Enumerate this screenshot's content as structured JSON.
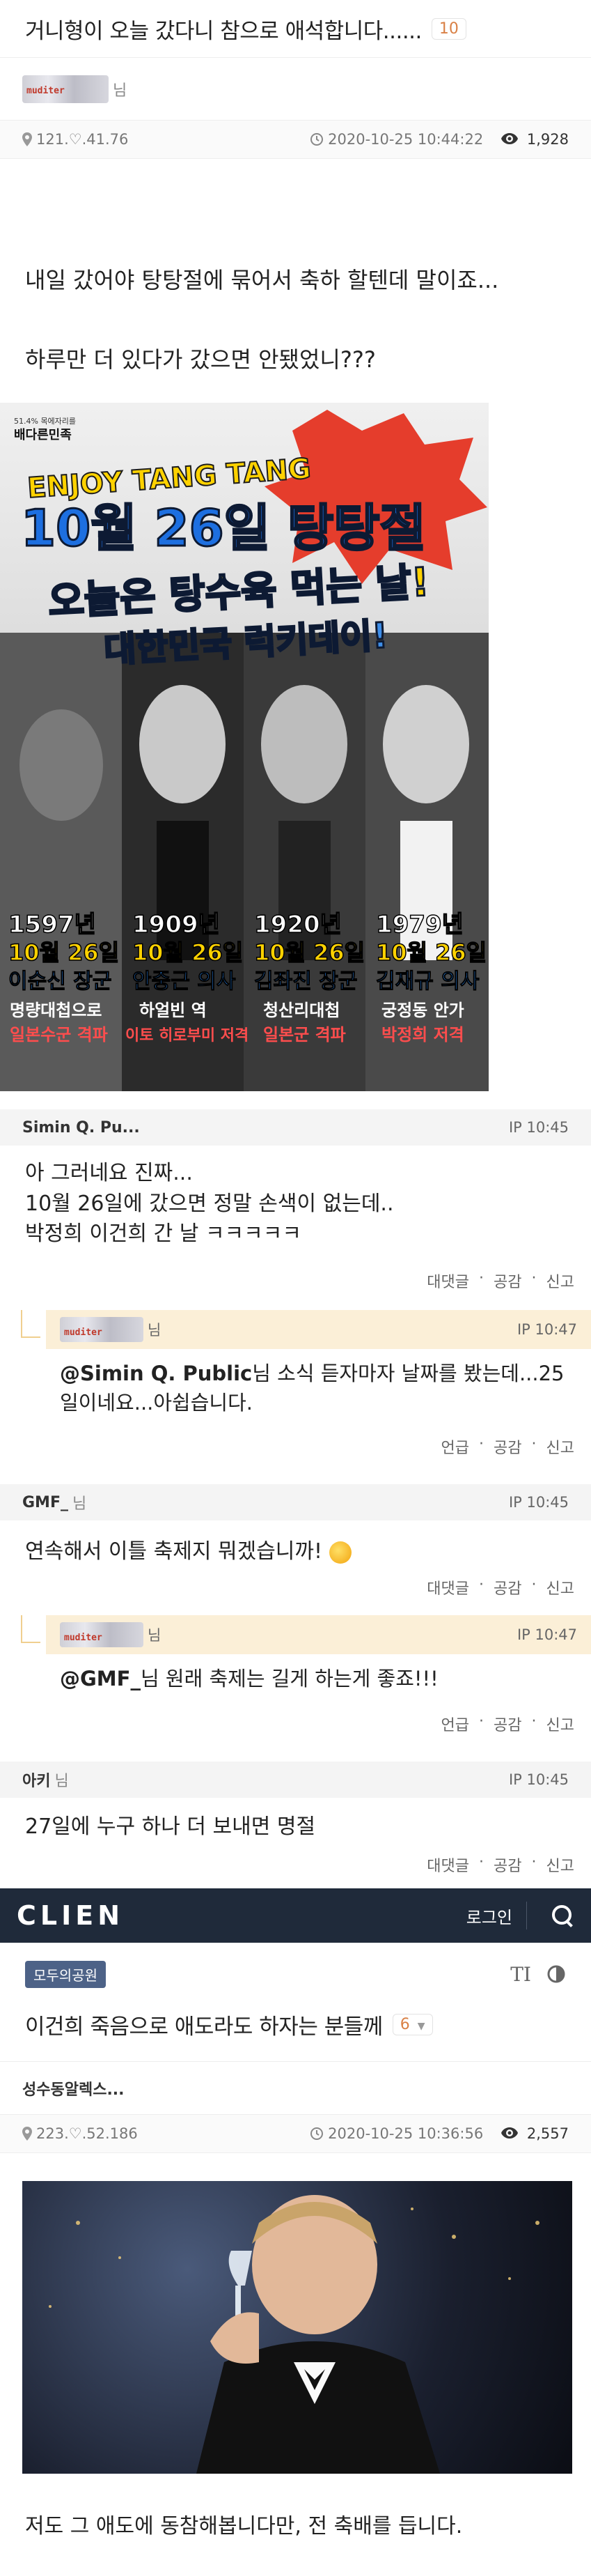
{
  "post1": {
    "title": "거니형이 오늘 갔다니 참으로 애석합니다......",
    "comment_count": "10",
    "author_suffix": "님",
    "ip": "121.♡.41.76",
    "datetime": "2020-10-25 10:44:22",
    "views": "1,928",
    "body_lines": [
      "내일 갔어야 탕탕절에 묶어서 축하 할텐데 말이죠...",
      "하루만 더 있다가 갔으면 안됐었니???"
    ],
    "nick_image_text": "muditer"
  },
  "poster": {
    "badge_small": "51.4% 목에자리를",
    "badge_brand": "배다른민족",
    "line1": "ENJOY TANG TANG",
    "line2": "10월 26일 탕탕절",
    "line3": "오늘은 탕수육 먹는 날!",
    "line4": "대한민국 럭키데이!",
    "cards": [
      {
        "year": "1597년",
        "date": "10월 26일",
        "name": "이순신 장군",
        "desc1": "명량대첩으로",
        "desc2": "일본수군 격파"
      },
      {
        "year": "1909년",
        "date": "10월 26일",
        "name": "안중근 의사",
        "desc1": "하얼빈 역",
        "desc2": "이토 히로부미 저격"
      },
      {
        "year": "1920년",
        "date": "10월 26일",
        "name": "김좌진 장군",
        "desc1": "청산리대첩",
        "desc2": "일본군 격파"
      },
      {
        "year": "1979년",
        "date": "10월 26일",
        "name": "김재규 의사",
        "desc1": "궁정동 안가",
        "desc2": "박정희 저격"
      }
    ]
  },
  "actions": {
    "reply": "대댓글",
    "sep": "·",
    "like": "공감",
    "report": "신고",
    "mention": "언급"
  },
  "comments": [
    {
      "nick": "Simin Q. Pu...",
      "ip": "IP 10:45",
      "lines": [
        "아 그러네요 진짜...",
        "10월 26일에 갔으면 정말 손색이 없는데..",
        "박정희 이건희 간 날 ㅋㅋㅋㅋㅋ"
      ]
    },
    {
      "nick": "GMF_",
      "suffix": "님",
      "ip": "IP 10:45",
      "lines": [
        "연속해서 이틀 축제지 뭐겠습니까!"
      ]
    },
    {
      "nick": "아키",
      "suffix": "님",
      "ip": "IP 10:45",
      "lines": [
        "27일에 누구 하나 더 보내면 명절"
      ]
    }
  ],
  "replies": [
    {
      "suffix": "님",
      "ip": "IP 10:47",
      "mention": "@Simin Q. Public",
      "text_after": "님 소식 듣자마자 날짜를 봤는데...25일이네요...아쉽습니다."
    },
    {
      "suffix": "님",
      "ip": "IP 10:47",
      "mention": "@GMF_",
      "text_after": "님 원래 축제는 길게 하는게 좋죠!!!"
    }
  ],
  "topbar": {
    "logo": "CLIEN",
    "login": "로그인"
  },
  "post2": {
    "board": "모두의공원",
    "title": "이건희 죽음으로 애도라도 하자는 분들께",
    "comment_count": "6",
    "author": "성수동알렉스...",
    "ip": "223.♡.52.186",
    "datetime": "2020-10-25 10:36:56",
    "views": "2,557",
    "body": "저도 그 애도에 동참해봅니다만, 전 축배를 듭니다."
  },
  "colors": {
    "topbar_bg": "#1f2a3a",
    "reply_bg": "#fbefd7",
    "comment_head_bg": "#f4f4f4",
    "badge_text": "#d98045",
    "board_chip": "#4d6287"
  }
}
